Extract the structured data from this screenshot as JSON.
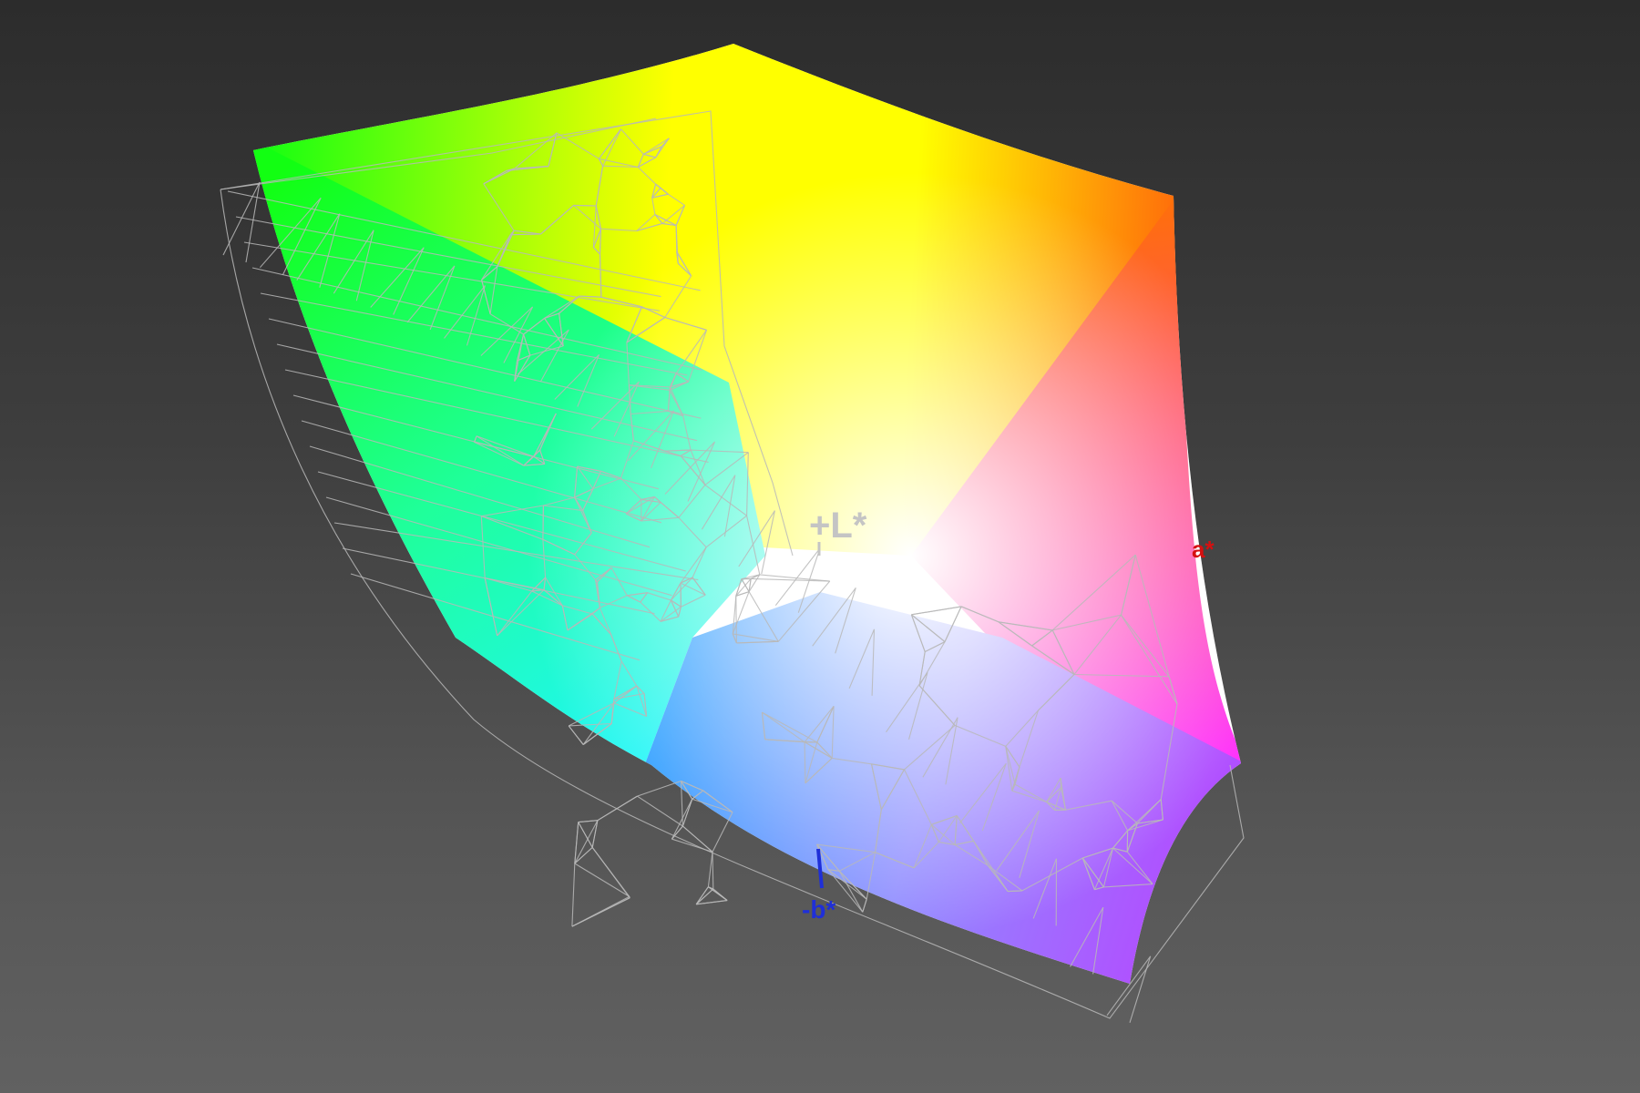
{
  "axes": {
    "l_plus": {
      "text": "+L*",
      "color": "#c4c4c4"
    },
    "a_plus": {
      "text": "a*",
      "color": "#d61010"
    },
    "b_minus": {
      "text": "-b*",
      "color": "#1f2fd8"
    }
  },
  "gamut_colors": {
    "green": "#12ff12",
    "yellow": "#ffff00",
    "orange": "#ff6f0a",
    "red_magenta": "#ff4a78",
    "magenta": "#ff33ff",
    "violet": "#b050ff",
    "blue": "#2a9cff",
    "cyan": "#1ff5ff",
    "white": "#ffffff",
    "wireframe": "#b8b8b8"
  }
}
